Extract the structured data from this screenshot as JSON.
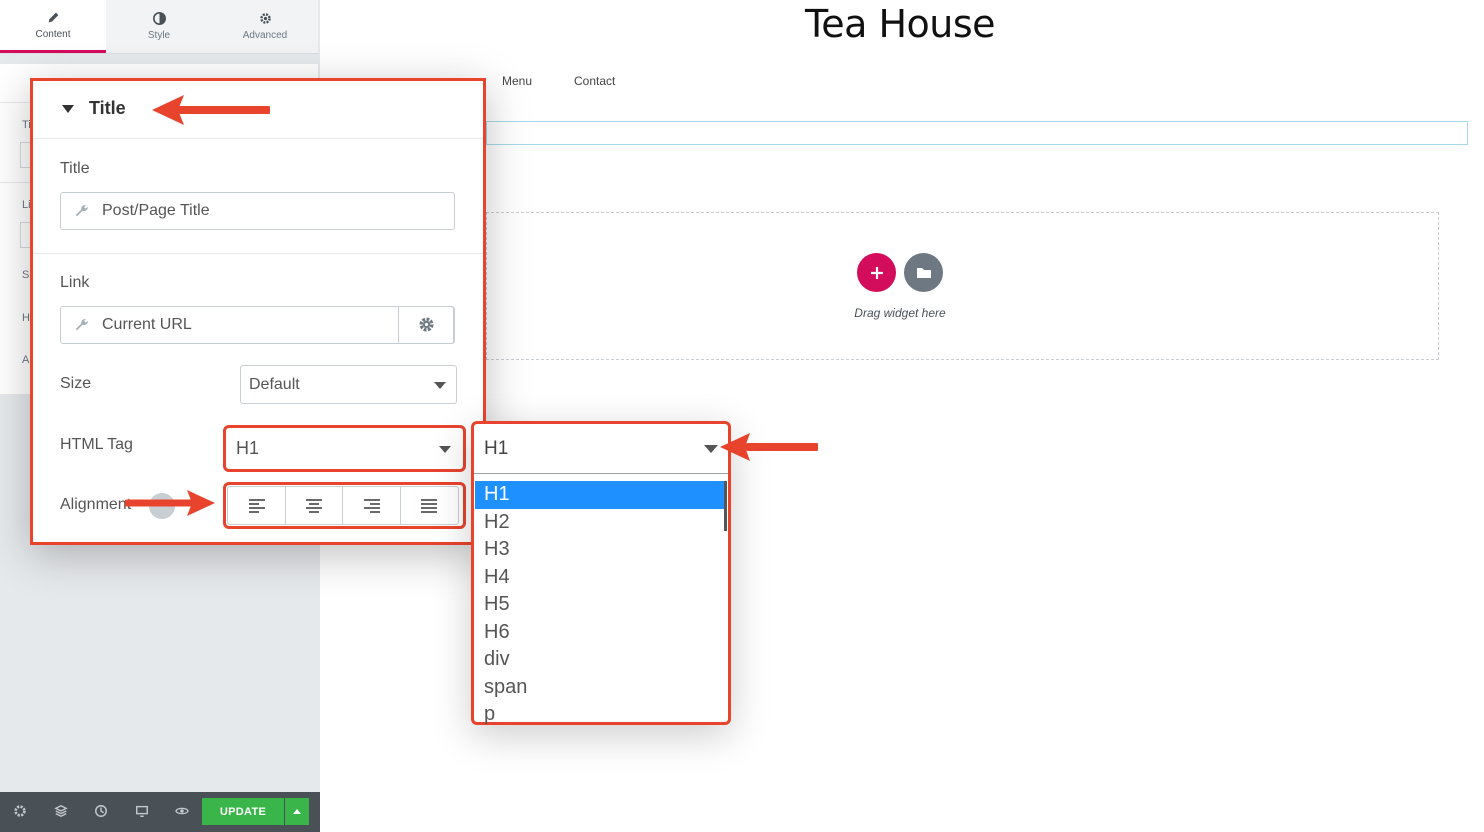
{
  "editor": {
    "tabs": [
      {
        "label": "Content",
        "icon": "pencil-icon",
        "active": true
      },
      {
        "label": "Style",
        "icon": "half-circle-icon",
        "active": false
      },
      {
        "label": "Advanced",
        "icon": "gear-icon",
        "active": false
      }
    ],
    "ghost_letters": [
      "Ti",
      "Li",
      "Si",
      "H",
      "Al"
    ],
    "footer": {
      "icons": [
        "settings-icon",
        "layers-icon",
        "history-icon",
        "responsive-icon",
        "preview-icon"
      ],
      "update_label": "UPDATE"
    }
  },
  "preview": {
    "site_title": "Tea House",
    "nav": [
      "Menu",
      "Contact"
    ],
    "drag_text": "Drag widget here"
  },
  "zoom_panel": {
    "section_title": "Title",
    "title_label": "Title",
    "title_value": "Post/Page Title",
    "link_label": "Link",
    "link_value": "Current URL",
    "size_label": "Size",
    "size_value": "Default",
    "html_tag_label": "HTML Tag",
    "html_tag_value": "H1",
    "alignment_label": "Alignment",
    "alignment_options": [
      "align-left-icon",
      "align-center-icon",
      "align-right-icon",
      "align-justify-icon"
    ]
  },
  "dropdown": {
    "selected": "H1",
    "options": [
      "H1",
      "H2",
      "H3",
      "H4",
      "H5",
      "H6",
      "div",
      "span",
      "p"
    ]
  },
  "colors": {
    "accent": "#e8442d",
    "brand": "#d30c5c",
    "update": "#39b54a",
    "selection": "#1e90ff"
  }
}
